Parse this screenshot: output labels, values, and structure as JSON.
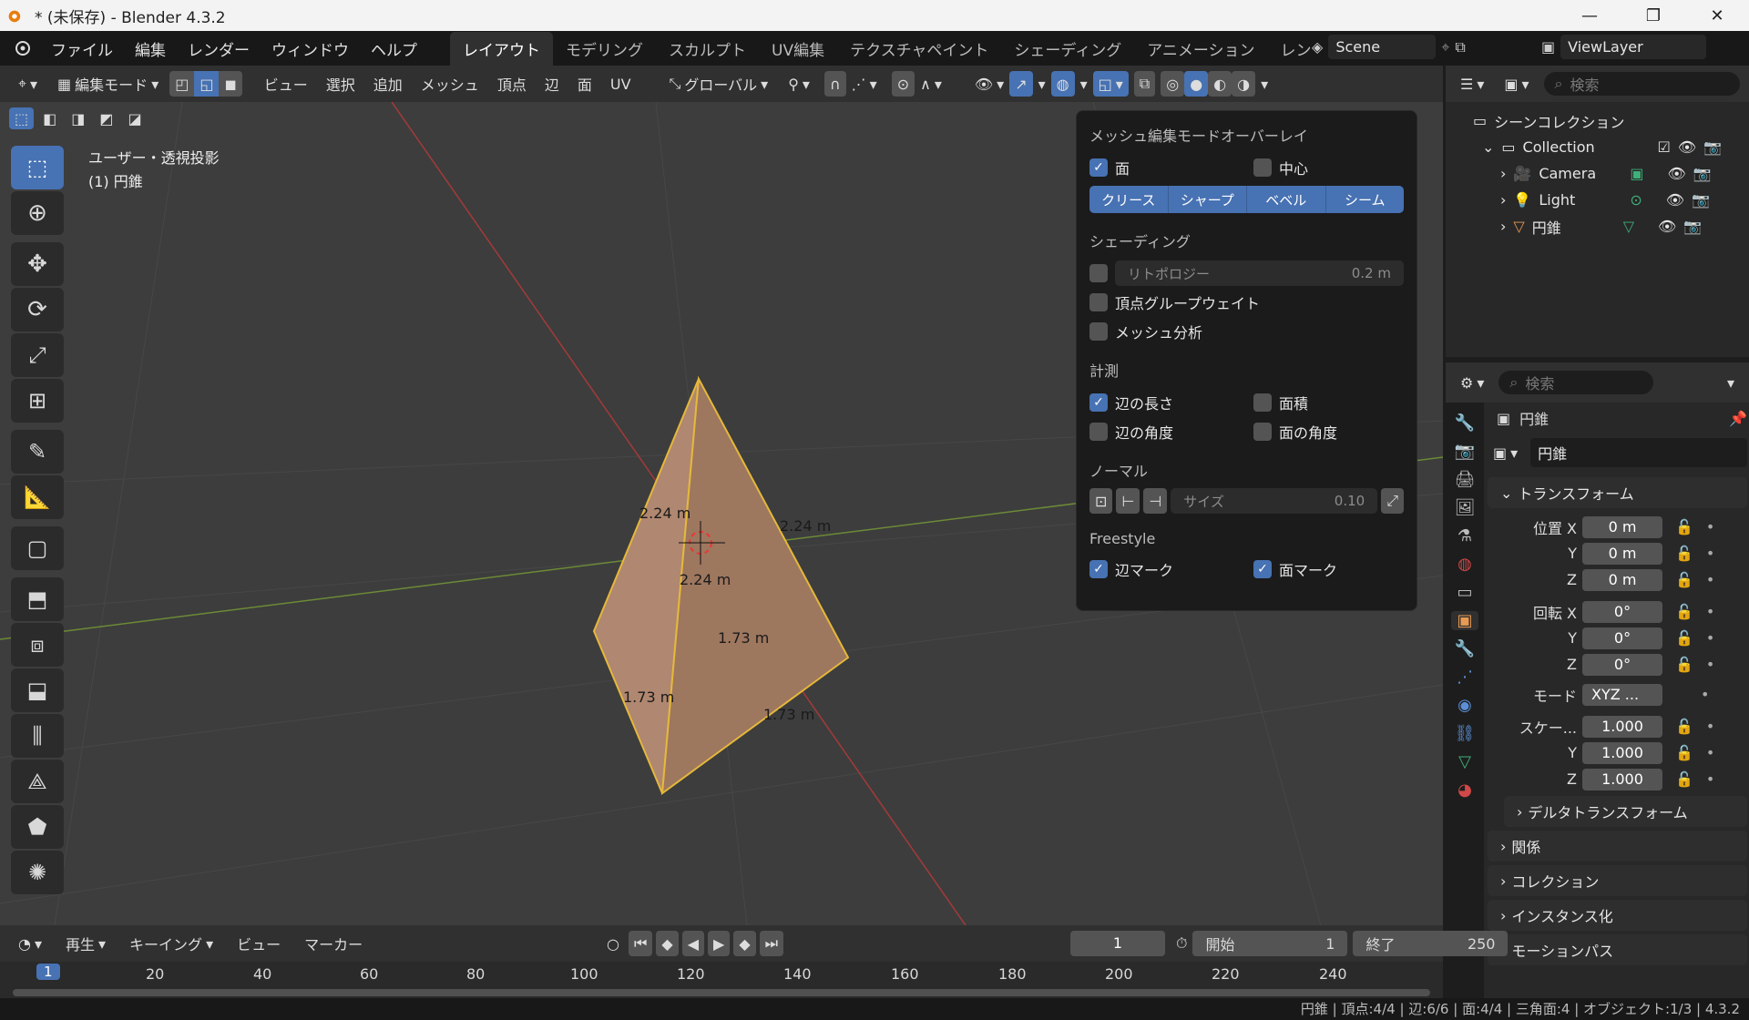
{
  "window": {
    "title": "* (未保存) - Blender 4.3.2",
    "min": "—",
    "max": "❐",
    "close": "✕"
  },
  "menu": [
    "ファイル",
    "編集",
    "レンダー",
    "ウィンドウ",
    "ヘルプ"
  ],
  "workspaces": [
    "レイアウト",
    "モデリング",
    "スカルプト",
    "UV編集",
    "テクスチャペイント",
    "シェーディング",
    "アニメーション",
    "レン"
  ],
  "scene": "Scene",
  "view_layer": "ViewLayer",
  "header": {
    "mode": "編集モード",
    "menus": [
      "ビュー",
      "選択",
      "追加",
      "メッシュ",
      "頂点",
      "辺",
      "面",
      "UV"
    ],
    "orientation": "グローバル"
  },
  "viewport": {
    "view_name": "ユーザー・透視投影",
    "object_line": "(1) 円錐",
    "labels": [
      "2.24 m",
      "2.24 m",
      "2.24 m",
      "1.73 m",
      "1.73 m",
      "1.73 m"
    ]
  },
  "overlay": {
    "title": "メッシュ編集モードオーバーレイ",
    "face": "面",
    "center": "中心",
    "seg": [
      "クリース",
      "シャープ",
      "ベベル",
      "シーム"
    ],
    "shading_h": "シェーディング",
    "retopology": "リトポロジー",
    "retopology_val": "0.2 m",
    "vertex_group": "頂点グループウェイト",
    "mesh_analysis": "メッシュ分析",
    "measure_h": "計測",
    "edge_len": "辺の長さ",
    "face_area": "面積",
    "edge_angle": "辺の角度",
    "face_angle": "面の角度",
    "normal_h": "ノーマル",
    "size_label": "サイズ",
    "size_val": "0.10",
    "freestyle_h": "Freestyle",
    "edge_mark": "辺マーク",
    "face_mark": "面マーク"
  },
  "outliner": {
    "search": "検索",
    "scene_collection": "シーンコレクション",
    "collection": "Collection",
    "items": [
      "Camera",
      "Light",
      "円錐"
    ]
  },
  "properties": {
    "search": "検索",
    "object_name": "円錐",
    "name_field": "円錐",
    "transform": "トランスフォーム",
    "location_label": "位置 X",
    "rotation_label": "回転 X",
    "scale_label": "スケー...",
    "y": "Y",
    "z": "Z",
    "loc": [
      "0 m",
      "0 m",
      "0 m"
    ],
    "rot": [
      "0°",
      "0°",
      "0°"
    ],
    "mode_label": "モード",
    "mode_val": "XYZ ...",
    "scale": [
      "1.000",
      "1.000",
      "1.000"
    ],
    "panels": [
      "デルタトランスフォーム",
      "関係",
      "コレクション",
      "インスタンス化",
      "モーションパス"
    ]
  },
  "timeline": {
    "play": "再生",
    "keying": "キーイング",
    "view": "ビュー",
    "marker": "マーカー",
    "frame": "1",
    "start_label": "開始",
    "start": "1",
    "end_label": "終了",
    "end": "250",
    "ticks": [
      "1",
      "20",
      "40",
      "60",
      "80",
      "100",
      "120",
      "140",
      "160",
      "180",
      "200",
      "220",
      "240"
    ]
  },
  "status": "円錐 | 頂点:4/4 | 辺:6/6 | 面:4/4 | 三角面:4 | オブジェクト:1/3 | 4.3.2"
}
